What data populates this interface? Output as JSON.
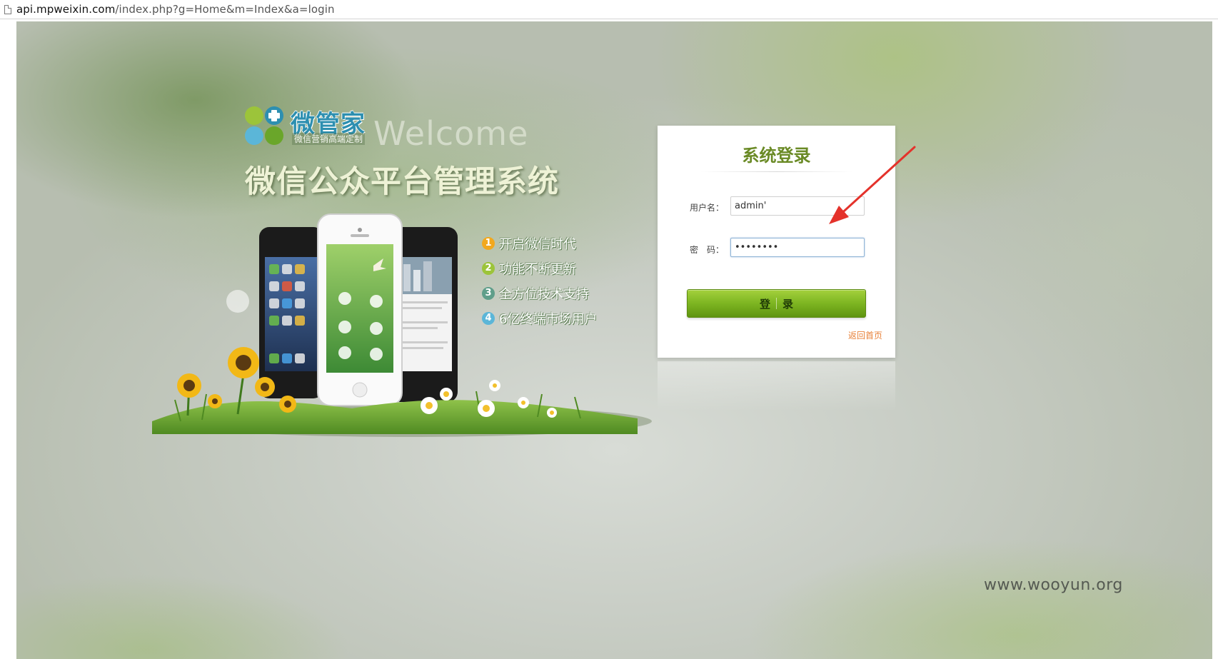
{
  "browser": {
    "url_host": "api.mpweixin.com",
    "url_path": "/index.php?g=Home&m=Index&a=login"
  },
  "brand": {
    "logo_name": "微管家",
    "logo_tagline": "微信营销高端定制",
    "welcome": "Welcome",
    "system_title": "微信公众平台管理系统"
  },
  "features": [
    {
      "num": "1",
      "text": "开启微信时代",
      "color": "#f2a81d"
    },
    {
      "num": "2",
      "text": "功能不断更新",
      "color": "#9cc43a"
    },
    {
      "num": "3",
      "text": "全方位技术支持",
      "color": "#5f9e8a"
    },
    {
      "num": "4",
      "text": "6亿终端市场用户",
      "color": "#5bb6d8"
    }
  ],
  "login": {
    "title": "系统登录",
    "username_label": "用户名：",
    "username_value": "admin'",
    "password_label": "密　码：",
    "password_value": "••••••••",
    "button_left": "登",
    "button_right": "录",
    "back_link": "返回首页"
  },
  "colors": {
    "accent_green": "#7db521",
    "title_green": "#6a8a25",
    "link_orange": "#e8823a",
    "annotation_red": "#e4322b"
  },
  "watermark": "www.wooyun.org"
}
